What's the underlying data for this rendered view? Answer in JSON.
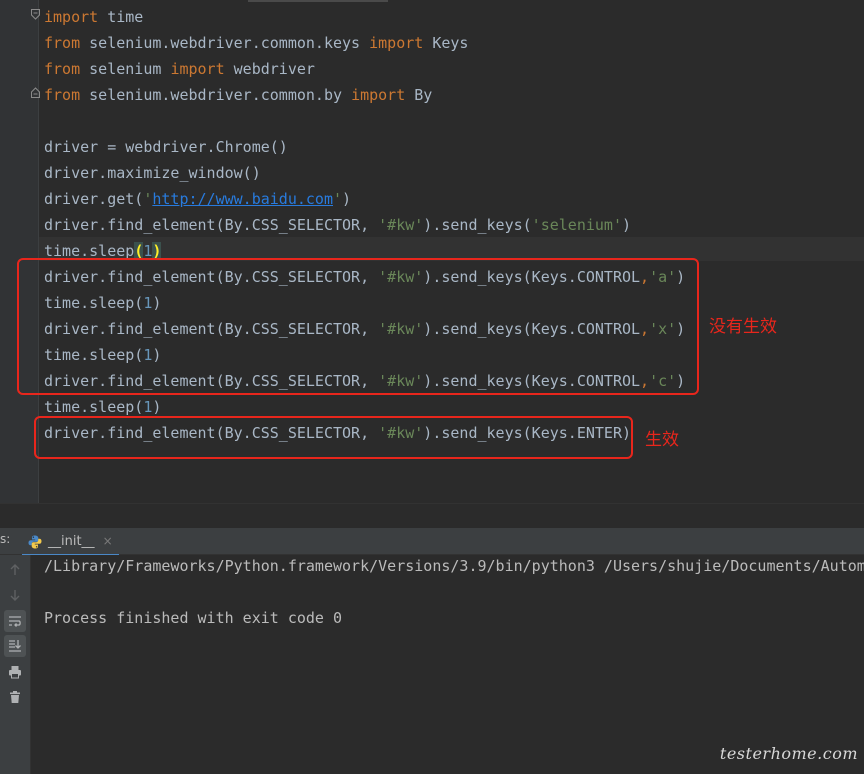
{
  "editor": {
    "lines": [
      [
        {
          "t": "import",
          "c": "kw"
        },
        {
          "t": " time",
          "c": ""
        }
      ],
      [
        {
          "t": "from",
          "c": "kw"
        },
        {
          "t": " selenium.webdriver.common.keys ",
          "c": ""
        },
        {
          "t": "import",
          "c": "kw"
        },
        {
          "t": " Keys",
          "c": ""
        }
      ],
      [
        {
          "t": "from",
          "c": "kw"
        },
        {
          "t": " selenium ",
          "c": ""
        },
        {
          "t": "import",
          "c": "kw"
        },
        {
          "t": " webdriver",
          "c": ""
        }
      ],
      [
        {
          "t": "from",
          "c": "kw"
        },
        {
          "t": " selenium.webdriver.common.by ",
          "c": ""
        },
        {
          "t": "import",
          "c": "kw"
        },
        {
          "t": " By",
          "c": ""
        }
      ],
      [],
      [
        {
          "t": "driver = webdriver.Chrome()",
          "c": ""
        }
      ],
      [
        {
          "t": "driver.maximize_window()",
          "c": ""
        }
      ],
      [
        {
          "t": "driver.get(",
          "c": ""
        },
        {
          "t": "'",
          "c": "str"
        },
        {
          "t": "http://www.baidu.com",
          "c": "url"
        },
        {
          "t": "'",
          "c": "str"
        },
        {
          "t": ")",
          "c": ""
        }
      ],
      [
        {
          "t": "driver.find_element(By.CSS_SELECTOR, ",
          "c": ""
        },
        {
          "t": "'#kw'",
          "c": "str"
        },
        {
          "t": ").send_keys(",
          "c": ""
        },
        {
          "t": "'selenium'",
          "c": "str"
        },
        {
          "t": ")",
          "c": ""
        }
      ],
      [
        {
          "t": "time.sleep",
          "c": ""
        },
        {
          "t": "(",
          "c": "hl-paren"
        },
        {
          "t": "1",
          "c": "num"
        },
        {
          "t": ")",
          "c": "hl-paren"
        }
      ],
      [
        {
          "t": "driver.find_element(By.CSS_SELECTOR, ",
          "c": ""
        },
        {
          "t": "'#kw'",
          "c": "str"
        },
        {
          "t": ").send_keys(Keys.CONTROL",
          "c": ""
        },
        {
          "t": ",",
          "c": "kw"
        },
        {
          "t": "'a'",
          "c": "str"
        },
        {
          "t": ")",
          "c": ""
        }
      ],
      [
        {
          "t": "time.sleep(",
          "c": ""
        },
        {
          "t": "1",
          "c": "num"
        },
        {
          "t": ")",
          "c": ""
        }
      ],
      [
        {
          "t": "driver.find_element(By.CSS_SELECTOR, ",
          "c": ""
        },
        {
          "t": "'#kw'",
          "c": "str"
        },
        {
          "t": ").send_keys(Keys.CONTROL",
          "c": ""
        },
        {
          "t": ",",
          "c": "kw"
        },
        {
          "t": "'x'",
          "c": "str"
        },
        {
          "t": ")",
          "c": ""
        }
      ],
      [
        {
          "t": "time.sleep(",
          "c": ""
        },
        {
          "t": "1",
          "c": "num"
        },
        {
          "t": ")",
          "c": ""
        }
      ],
      [
        {
          "t": "driver.find_element(By.CSS_SELECTOR, ",
          "c": ""
        },
        {
          "t": "'#kw'",
          "c": "str"
        },
        {
          "t": ").send_keys(Keys.CONTROL",
          "c": ""
        },
        {
          "t": ",",
          "c": "kw"
        },
        {
          "t": "'c'",
          "c": "str"
        },
        {
          "t": ")",
          "c": ""
        }
      ],
      [
        {
          "t": "time.sleep(",
          "c": ""
        },
        {
          "t": "1",
          "c": "num"
        },
        {
          "t": ")",
          "c": ""
        }
      ],
      [
        {
          "t": "driver.find_element(By.CSS_SELECTOR, ",
          "c": ""
        },
        {
          "t": "'#kw'",
          "c": "str"
        },
        {
          "t": ").send_keys(Keys.ENTER)",
          "c": ""
        }
      ]
    ]
  },
  "annotations": {
    "not_effective": "没有生效",
    "effective": "生效"
  },
  "run_panel": {
    "edge_label": "s:",
    "tab_label": "__init__",
    "tab_close": "×",
    "output_lines": [
      "/Library/Frameworks/Python.framework/Versions/3.9/bin/python3 /Users/shujie/Documents/Autom",
      "",
      "Process finished with exit code 0"
    ]
  },
  "watermark": "testerhome.com",
  "colors": {
    "keyword": "#cc7832",
    "string": "#6a8759",
    "number": "#6897bb",
    "link": "#287bde",
    "annotation": "#e8261c"
  }
}
